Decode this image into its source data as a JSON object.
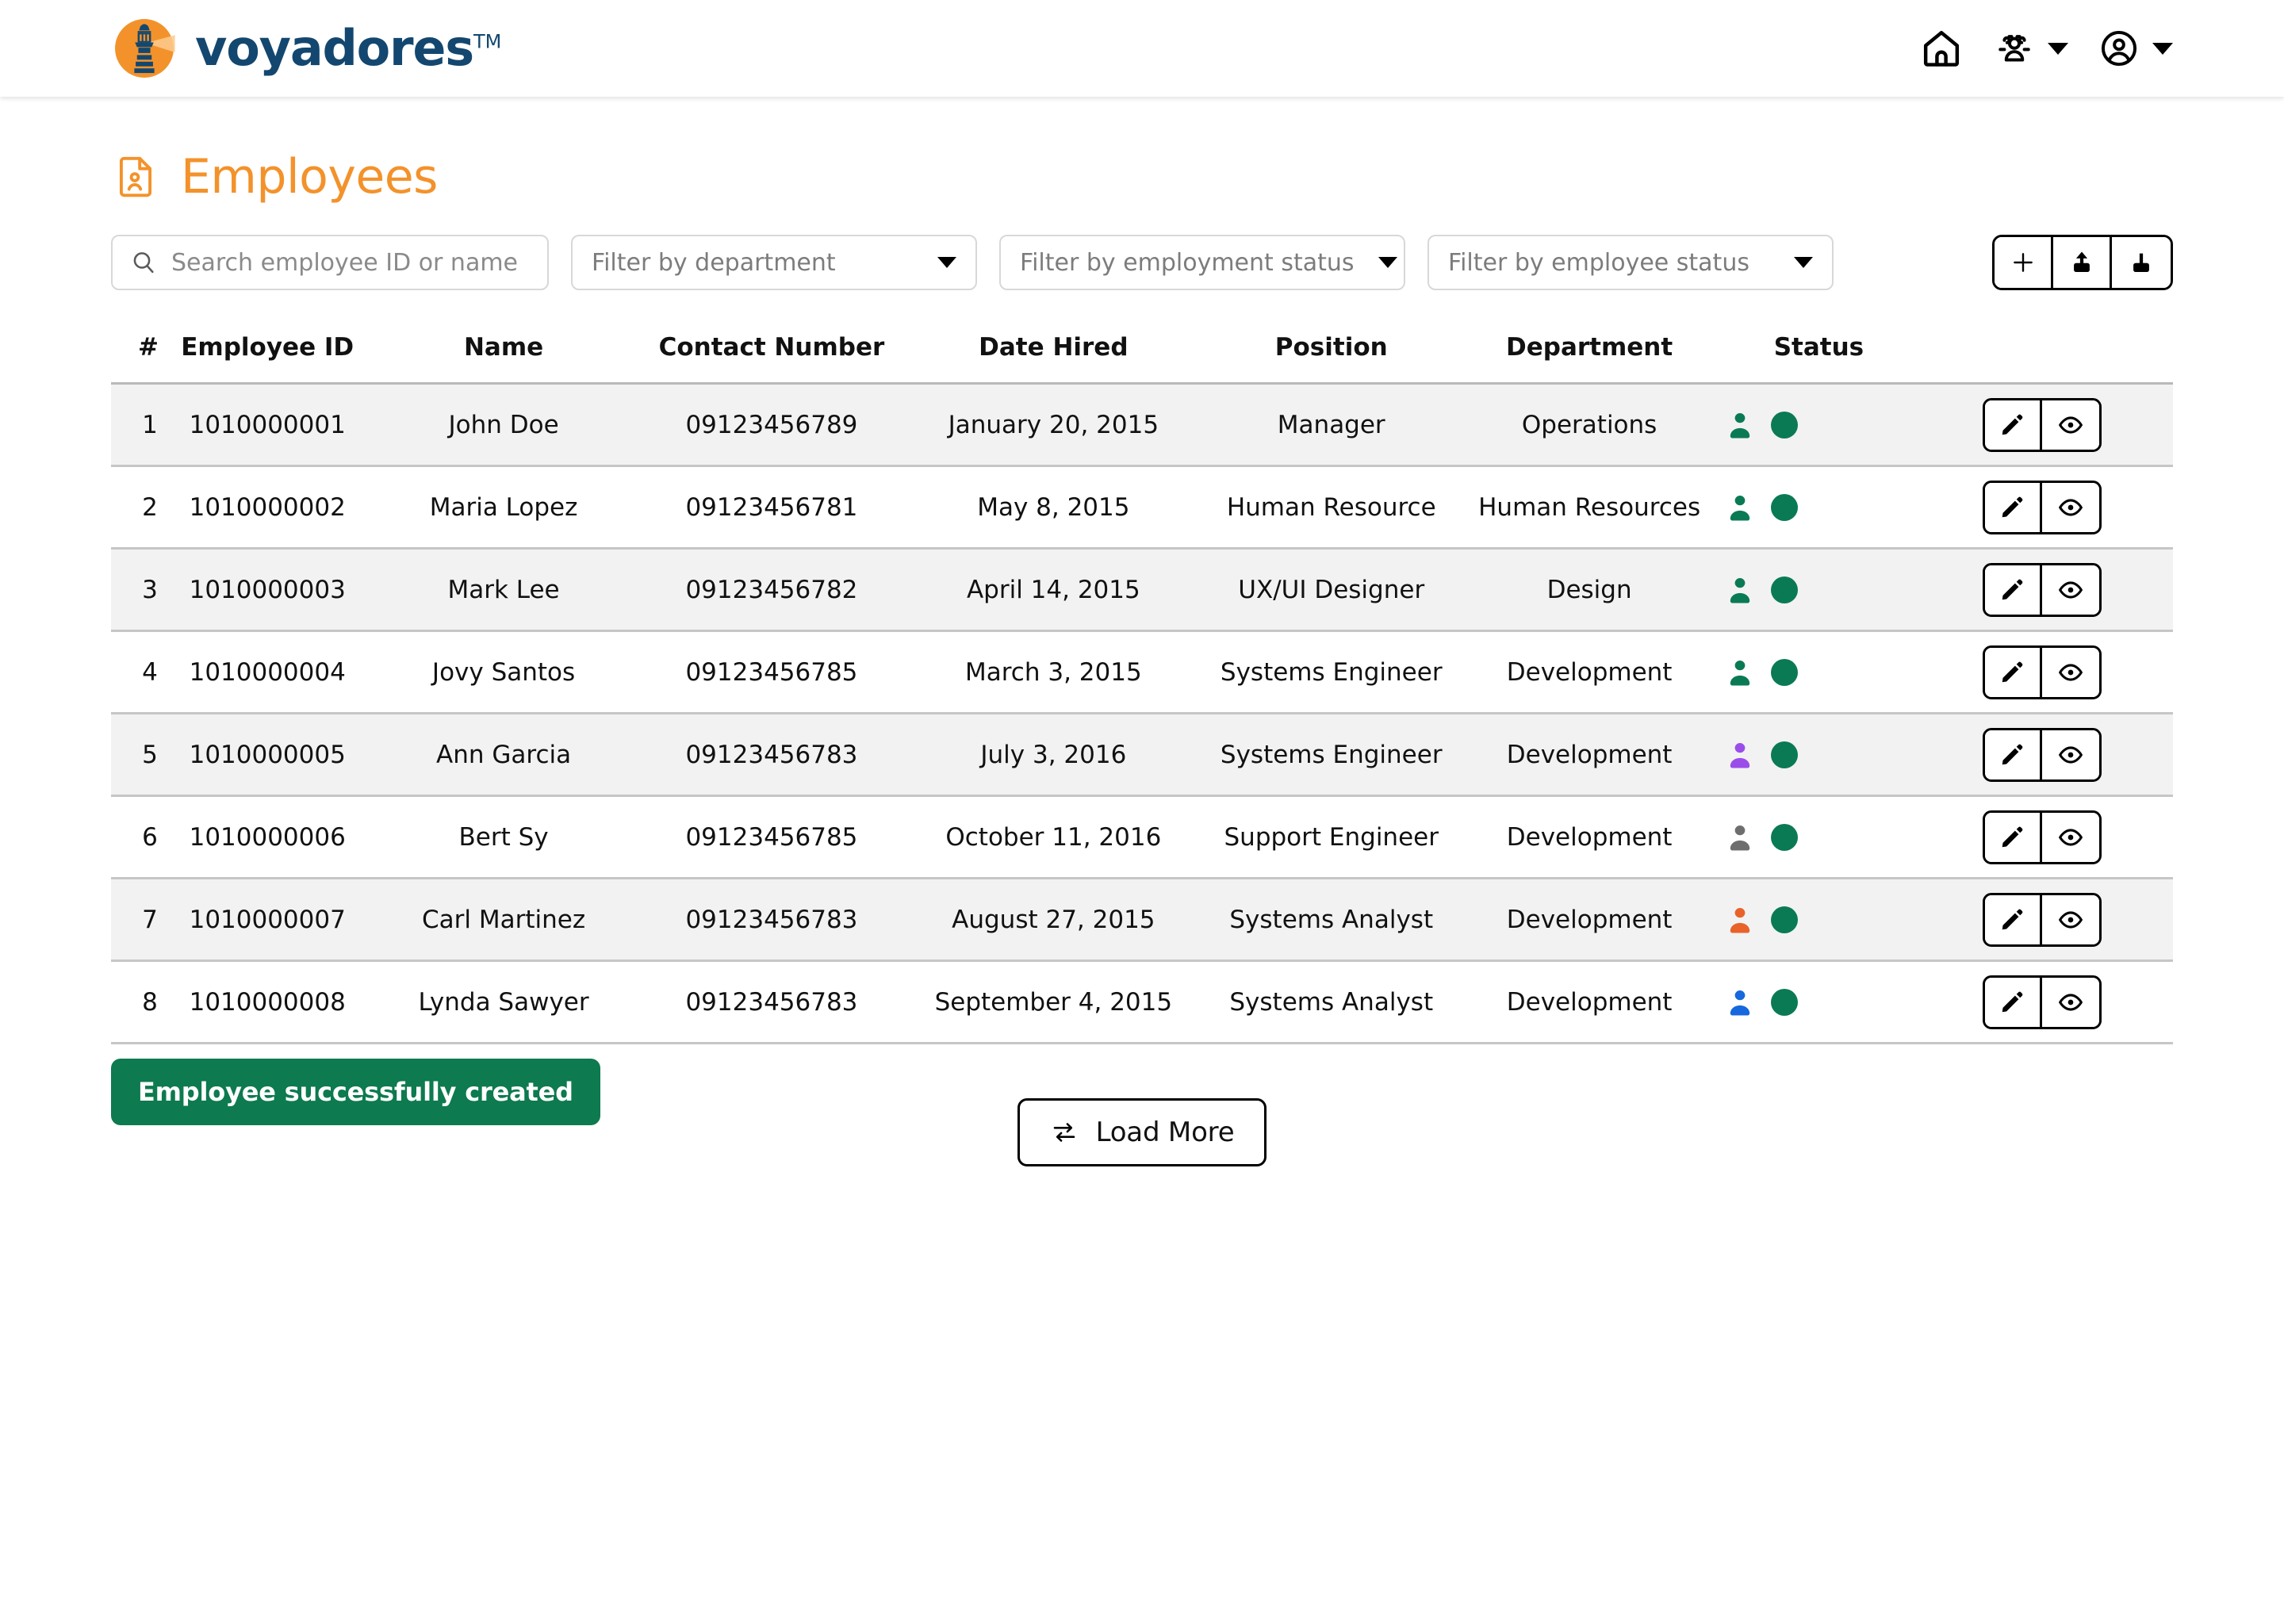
{
  "brand": {
    "name": "voyadores",
    "tm": "TM",
    "logo_icon": "lighthouse-logo-icon",
    "accent_orange": "#F3922B",
    "brand_navy": "#13476F"
  },
  "header": {
    "nav": [
      {
        "icon": "home-icon",
        "has_caret": false
      },
      {
        "icon": "people-group-icon",
        "has_caret": true
      },
      {
        "icon": "account-circle-icon",
        "has_caret": true
      }
    ]
  },
  "page": {
    "title": "Employees",
    "title_icon": "employee-document-icon"
  },
  "toolbar": {
    "search": {
      "icon": "search-icon",
      "value": "",
      "placeholder": "Search employee ID or name"
    },
    "filters": [
      {
        "id": "department",
        "label": "Filter by department"
      },
      {
        "id": "employment-status",
        "label": "Filter by employment status"
      },
      {
        "id": "employee-status",
        "label": "Filter by employee status"
      }
    ],
    "actions": [
      {
        "name": "add-employee-button",
        "icon": "plus-icon"
      },
      {
        "name": "export-employees-button",
        "icon": "upload-icon"
      },
      {
        "name": "import-employees-button",
        "icon": "download-icon"
      }
    ]
  },
  "table": {
    "columns": [
      "#",
      "Employee ID",
      "Name",
      "Contact Number",
      "Date Hired",
      "Position",
      "Department",
      "Status",
      ""
    ],
    "row_actions": [
      {
        "name": "edit-row-button",
        "icon": "pencil-icon"
      },
      {
        "name": "view-row-button",
        "icon": "eye-icon"
      }
    ],
    "rows": [
      {
        "num": "1",
        "employee_id": "1010000001",
        "name": "John Doe",
        "contact_number": "09123456789",
        "date_hired": "January 20, 2015",
        "position": "Manager",
        "department": "Operations",
        "person_color": "#0A7A55",
        "dot_color": "#0A7A55"
      },
      {
        "num": "2",
        "employee_id": "1010000002",
        "name": "Maria Lopez",
        "contact_number": "09123456781",
        "date_hired": "May 8, 2015",
        "position": "Human Resource",
        "department": "Human Resources",
        "person_color": "#0A7A55",
        "dot_color": "#0A7A55"
      },
      {
        "num": "3",
        "employee_id": "1010000003",
        "name": "Mark Lee",
        "contact_number": "09123456782",
        "date_hired": "April 14, 2015",
        "position": "UX/UI Designer",
        "department": "Design",
        "person_color": "#0A7A55",
        "dot_color": "#0A7A55"
      },
      {
        "num": "4",
        "employee_id": "1010000004",
        "name": "Jovy Santos",
        "contact_number": "09123456785",
        "date_hired": "March 3, 2015",
        "position": "Systems Engineer",
        "department": "Development",
        "person_color": "#0A7A55",
        "dot_color": "#0A7A55"
      },
      {
        "num": "5",
        "employee_id": "1010000005",
        "name": "Ann Garcia",
        "contact_number": "09123456783",
        "date_hired": "July 3, 2016",
        "position": "Systems Engineer",
        "department": "Development",
        "person_color": "#9B4DEA",
        "dot_color": "#0A7A55"
      },
      {
        "num": "6",
        "employee_id": "1010000006",
        "name": "Bert Sy",
        "contact_number": "09123456785",
        "date_hired": "October 11, 2016",
        "position": "Support Engineer",
        "department": "Development",
        "person_color": "#6E6E6E",
        "dot_color": "#0A7A55"
      },
      {
        "num": "7",
        "employee_id": "1010000007",
        "name": "Carl Martinez",
        "contact_number": "09123456783",
        "date_hired": "August 27, 2015",
        "position": "Systems Analyst",
        "department": "Development",
        "person_color": "#E8622A",
        "dot_color": "#0A7A55"
      },
      {
        "num": "8",
        "employee_id": "1010000008",
        "name": "Lynda Sawyer",
        "contact_number": "09123456783",
        "date_hired": "September 4, 2015",
        "position": "Systems Analyst",
        "department": "Development",
        "person_color": "#1668DC",
        "dot_color": "#0A7A55"
      }
    ]
  },
  "load_more": {
    "label": "Load More",
    "icon": "refresh-swap-icon"
  },
  "toast": {
    "message": "Employee successfully created",
    "background": "#0D7A4F"
  }
}
